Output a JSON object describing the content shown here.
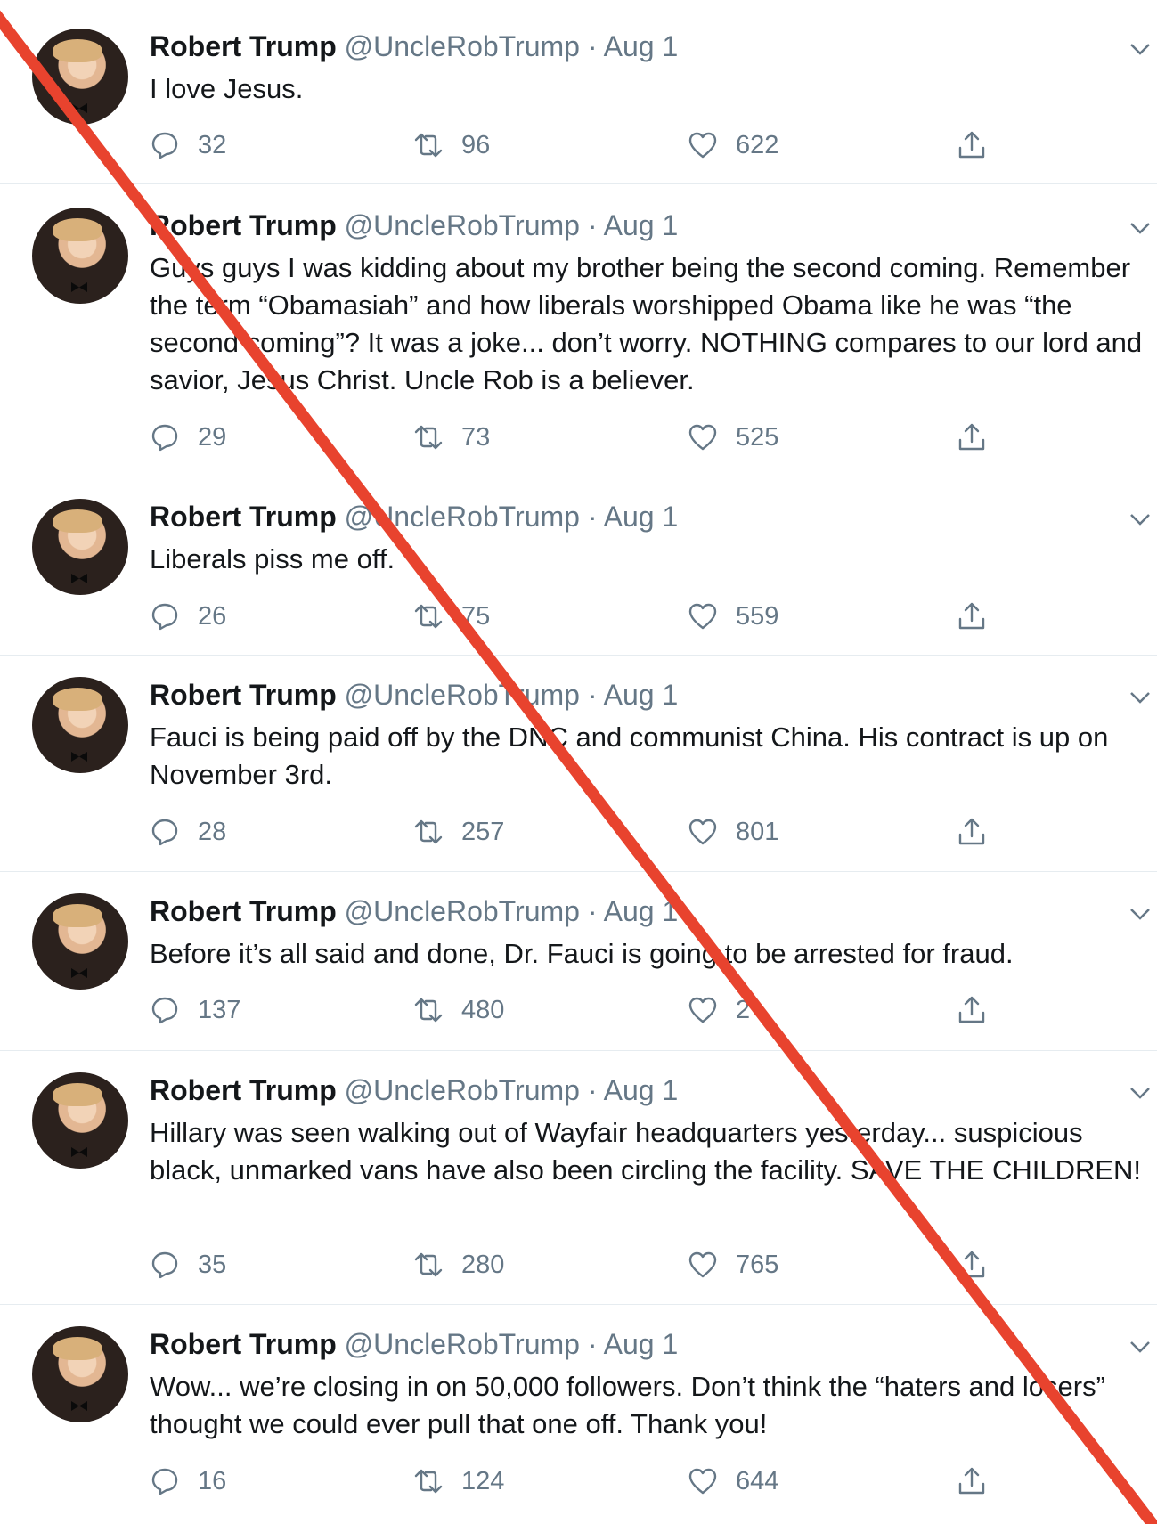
{
  "timeline": {
    "tweets": [
      {
        "name": "Robert Trump",
        "handle": "@UncleRobTrump",
        "separator": "·",
        "date": "Aug 1",
        "text": "I love Jesus.",
        "replies": "32",
        "retweets": "96",
        "likes": "622"
      },
      {
        "name": "Robert Trump",
        "handle": "@UncleRobTrump",
        "separator": "·",
        "date": "Aug 1",
        "text": "Guys guys I was kidding about my brother being the second coming. Remember the term “Obamasiah” and how liberals worshipped Obama like he was “the second coming”? It was a joke... don’t worry. NOTHING compares to our lord and savior, Jesus Christ. Uncle Rob is a believer.",
        "replies": "29",
        "retweets": "73",
        "likes": "525"
      },
      {
        "name": "Robert Trump",
        "handle": "@UncleRobTrump",
        "separator": "·",
        "date": "Aug 1",
        "text": "Liberals piss me off.",
        "replies": "26",
        "retweets": "75",
        "likes": "559"
      },
      {
        "name": "Robert Trump",
        "handle": "@UncleRobTrump",
        "separator": "·",
        "date": "Aug 1",
        "text": "Fauci is being paid off by the DNC and communist China. His contract is up on November 3rd.",
        "replies": "28",
        "retweets": "257",
        "likes": "801"
      },
      {
        "name": "Robert Trump",
        "handle": "@UncleRobTrump",
        "separator": "·",
        "date": "Aug 1",
        "text": "Before it’s all said and done, Dr. Fauci is going to be arrested for fraud.",
        "replies": "137",
        "retweets": "480",
        "likes": "2"
      },
      {
        "name": "Robert Trump",
        "handle": "@UncleRobTrump",
        "separator": "·",
        "date": "Aug 1",
        "text": "Hillary was seen walking out of Wayfair headquarters yesterday... suspicious black, unmarked vans have also been circling the facility. SAVE THE CHILDREN!",
        "replies": "35",
        "retweets": "280",
        "likes": "765"
      },
      {
        "name": "Robert Trump",
        "handle": "@UncleRobTrump",
        "separator": "·",
        "date": "Aug 1",
        "text": "Wow... we’re closing in on 50,000 followers. Don’t think the “haters and losers” thought we could ever pull that one off. Thank you!",
        "replies": "16",
        "retweets": "124",
        "likes": "644"
      }
    ]
  },
  "colors": {
    "accent_slash": "#e8432e",
    "secondary_text": "#657786",
    "divider": "#e6ecf0"
  },
  "icons": [
    "reply-icon",
    "retweet-icon",
    "like-icon",
    "share-icon",
    "chevron-down-icon"
  ]
}
